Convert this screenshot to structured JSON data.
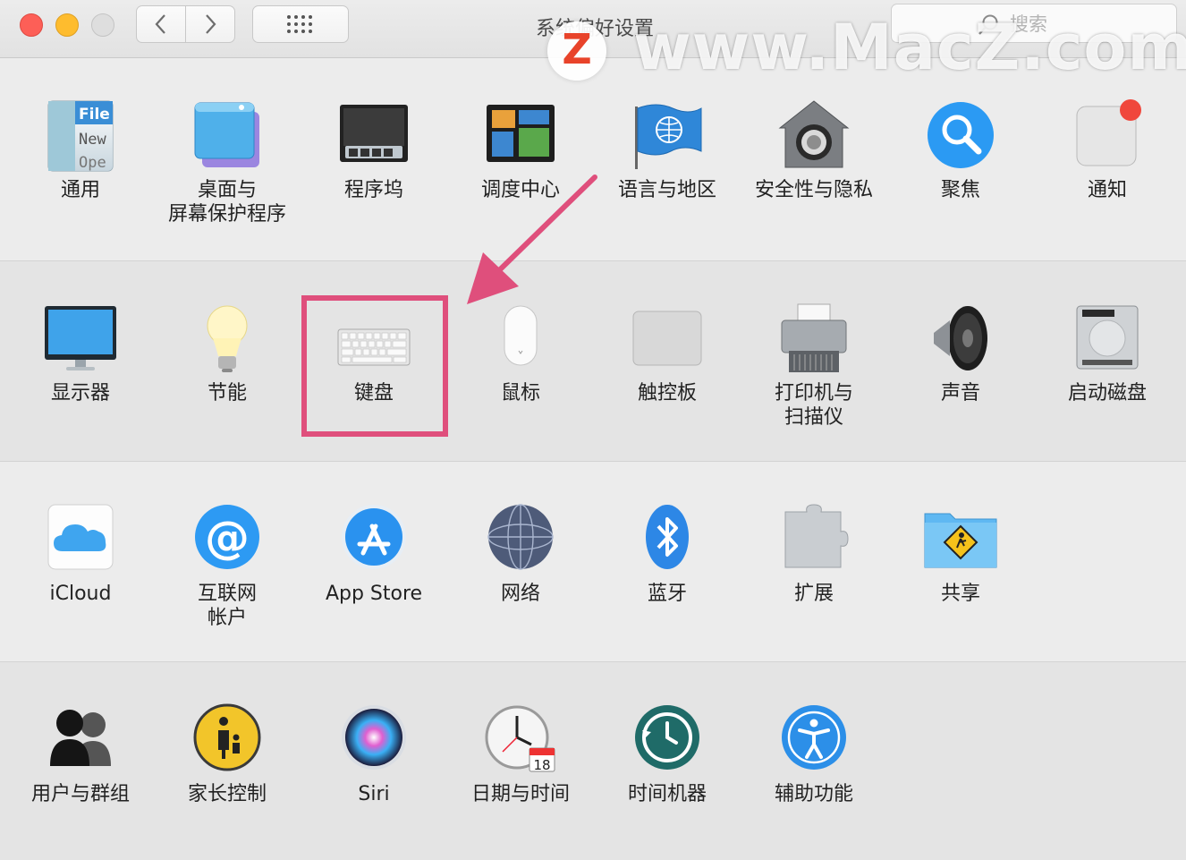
{
  "window": {
    "title": "系统偏好设置"
  },
  "search": {
    "placeholder": "搜索"
  },
  "watermark": {
    "logo_letter": "Z",
    "text": "www.MacZ.com"
  },
  "rows": [
    [
      {
        "id": "general",
        "label": "通用",
        "icon": "general-icon"
      },
      {
        "id": "desktop",
        "label": "桌面与\n屏幕保护程序",
        "icon": "desktop-screensaver-icon"
      },
      {
        "id": "dock",
        "label": "程序坞",
        "icon": "dock-icon"
      },
      {
        "id": "mission",
        "label": "调度中心",
        "icon": "mission-control-icon"
      },
      {
        "id": "language",
        "label": "语言与地区",
        "icon": "language-region-icon"
      },
      {
        "id": "security",
        "label": "安全性与隐私",
        "icon": "security-privacy-icon"
      },
      {
        "id": "spotlight",
        "label": "聚焦",
        "icon": "spotlight-icon"
      },
      {
        "id": "notifications",
        "label": "通知",
        "icon": "notifications-icon"
      }
    ],
    [
      {
        "id": "displays",
        "label": "显示器",
        "icon": "displays-icon"
      },
      {
        "id": "energy",
        "label": "节能",
        "icon": "energy-saver-icon"
      },
      {
        "id": "keyboard",
        "label": "键盘",
        "icon": "keyboard-icon"
      },
      {
        "id": "mouse",
        "label": "鼠标",
        "icon": "mouse-icon"
      },
      {
        "id": "trackpad",
        "label": "触控板",
        "icon": "trackpad-icon"
      },
      {
        "id": "printers",
        "label": "打印机与\n扫描仪",
        "icon": "printer-scanner-icon"
      },
      {
        "id": "sound",
        "label": "声音",
        "icon": "sound-icon"
      },
      {
        "id": "startup",
        "label": "启动磁盘",
        "icon": "startup-disk-icon"
      }
    ],
    [
      {
        "id": "icloud",
        "label": "iCloud",
        "icon": "icloud-icon"
      },
      {
        "id": "internet",
        "label": "互联网\n帐户",
        "icon": "internet-accounts-icon"
      },
      {
        "id": "appstore",
        "label": "App Store",
        "icon": "app-store-icon"
      },
      {
        "id": "network",
        "label": "网络",
        "icon": "network-icon"
      },
      {
        "id": "bluetooth",
        "label": "蓝牙",
        "icon": "bluetooth-icon"
      },
      {
        "id": "extensions",
        "label": "扩展",
        "icon": "extensions-icon"
      },
      {
        "id": "sharing",
        "label": "共享",
        "icon": "sharing-icon"
      }
    ],
    [
      {
        "id": "users",
        "label": "用户与群组",
        "icon": "users-groups-icon"
      },
      {
        "id": "parental",
        "label": "家长控制",
        "icon": "parental-controls-icon"
      },
      {
        "id": "siri",
        "label": "Siri",
        "icon": "siri-icon"
      },
      {
        "id": "datetime",
        "label": "日期与时间",
        "icon": "date-time-icon"
      },
      {
        "id": "timemachine",
        "label": "时间机器",
        "icon": "time-machine-icon"
      },
      {
        "id": "accessibility",
        "label": "辅助功能",
        "icon": "accessibility-icon"
      }
    ]
  ],
  "icon_text": {
    "general_file": "File",
    "general_new": "New",
    "general_open": "Ope",
    "calendar_day": "18"
  },
  "highlight": {
    "target": "keyboard",
    "color": "#df4f7c"
  }
}
